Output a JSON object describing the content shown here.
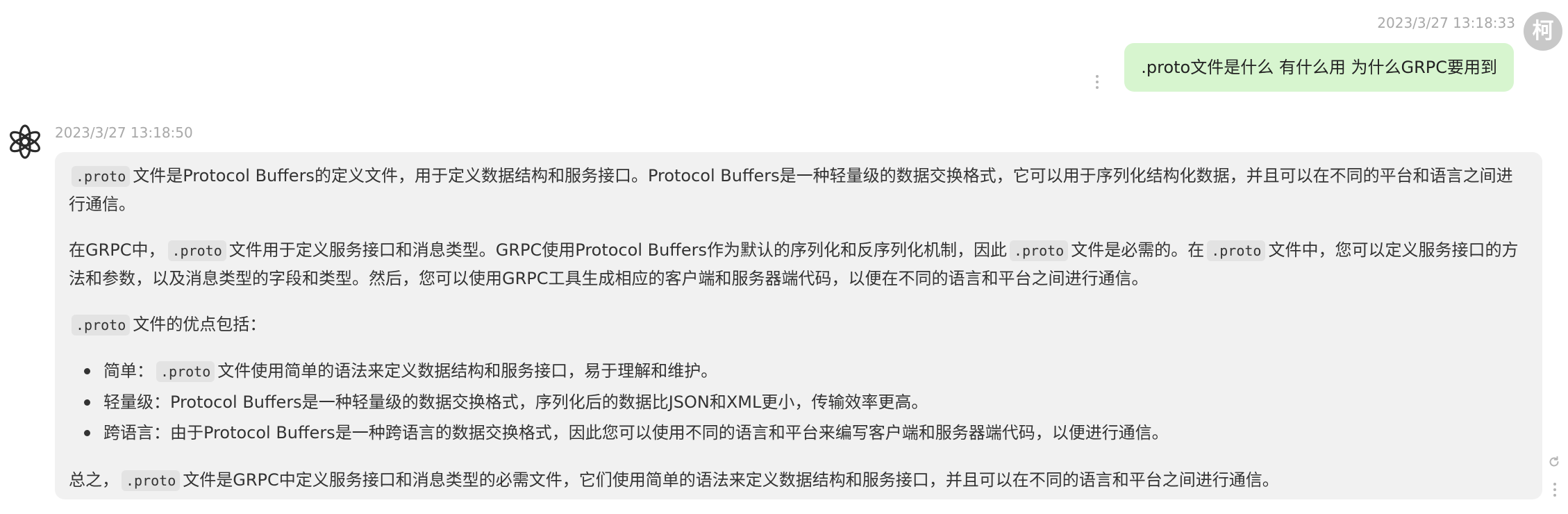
{
  "user_message": {
    "timestamp": "2023/3/27 13:18:33",
    "avatar_char": "柯",
    "text": ".proto文件是什么 有什么用 为什么GRPC要用到"
  },
  "assistant_message": {
    "timestamp": "2023/3/27 13:18:50",
    "p1": {
      "code": ".proto",
      "text": "文件是Protocol Buffers的定义文件，用于定义数据结构和服务接口。Protocol Buffers是一种轻量级的数据交换格式，它可以用于序列化结构化数据，并且可以在不同的平台和语言之间进行通信。"
    },
    "p2": {
      "t1": "在GRPC中，",
      "c1": ".proto",
      "t2": "文件用于定义服务接口和消息类型。GRPC使用Protocol Buffers作为默认的序列化和反序列化机制，因此",
      "c2": ".proto",
      "t3": "文件是必需的。在",
      "c3": ".proto",
      "t4": "文件中，您可以定义服务接口的方法和参数，以及消息类型的字段和类型。然后，您可以使用GRPC工具生成相应的客户端和服务器端代码，以便在不同的语言和平台之间进行通信。"
    },
    "p3": {
      "code": ".proto",
      "text": "文件的优点包括："
    },
    "points": [
      {
        "t1": "简单：",
        "code": ".proto",
        "t2": "文件使用简单的语法来定义数据结构和服务接口，易于理解和维护。"
      },
      {
        "t1": "轻量级：Protocol Buffers是一种轻量级的数据交换格式，序列化后的数据比JSON和XML更小，传输效率更高。"
      },
      {
        "t1": "跨语言：由于Protocol Buffers是一种跨语言的数据交换格式，因此您可以使用不同的语言和平台来编写客户端和服务器端代码，以便进行通信。"
      }
    ],
    "p4": {
      "t1": "总之，",
      "code": ".proto",
      "t2": "文件是GRPC中定义服务接口和消息类型的必需文件，它们使用简单的语法来定义数据结构和服务接口，并且可以在不同的语言和平台之间进行通信。"
    }
  },
  "icons": {
    "bot_avatar": "openai-logo-icon",
    "user_more": "more-vertical-icon",
    "bot_refresh": "refresh-icon",
    "bot_more": "more-vertical-icon"
  },
  "colors": {
    "user_bubble": "#d7f5cf",
    "bot_bubble": "#f1f1f1",
    "timestamp": "#a8a8a8",
    "avatar_bg": "#c8c8c8"
  }
}
